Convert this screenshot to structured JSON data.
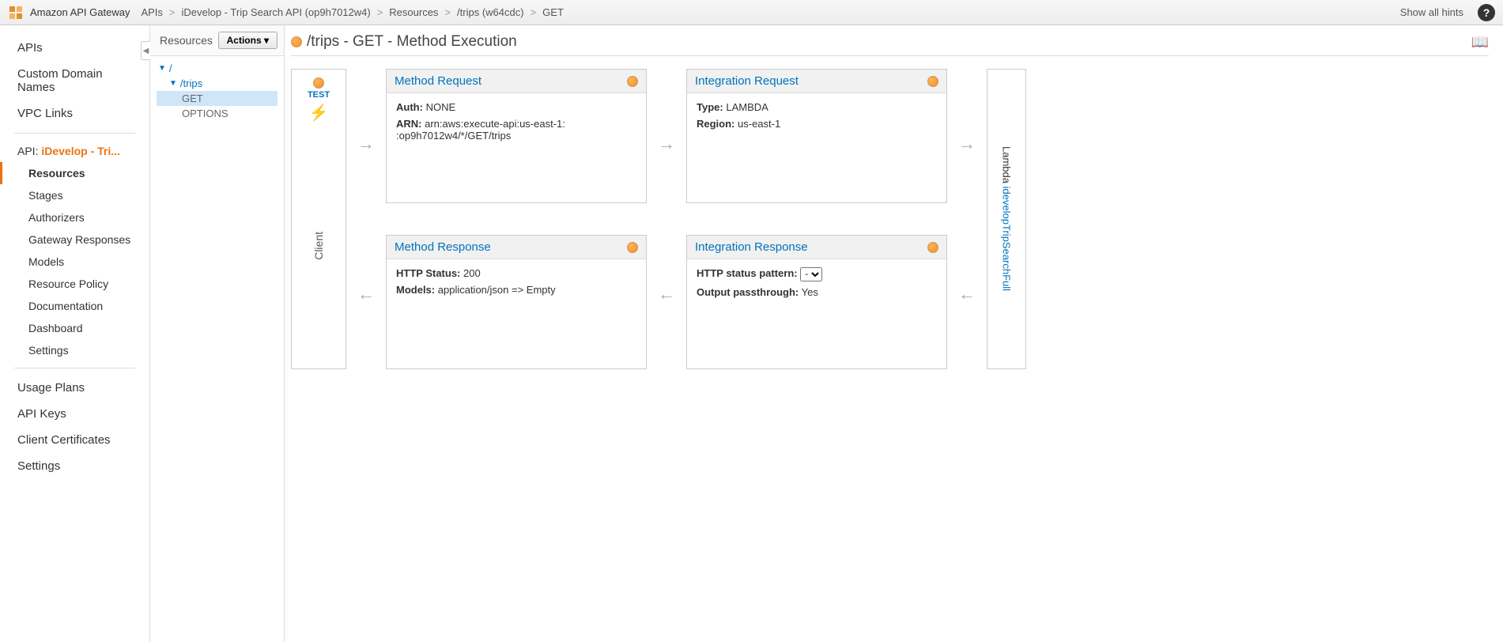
{
  "topbar": {
    "service": "Amazon API Gateway",
    "crumbs": [
      "APIs",
      "iDevelop - Trip Search API (op9h7012w4)",
      "Resources",
      "/trips (w64cdc)",
      "GET"
    ],
    "show_hints": "Show all hints"
  },
  "sidebar": {
    "items_top": [
      "APIs",
      "Custom Domain Names",
      "VPC Links"
    ],
    "api_label_prefix": "API: ",
    "api_name": "iDevelop - Tri...",
    "sub_items": [
      "Resources",
      "Stages",
      "Authorizers",
      "Gateway Responses",
      "Models",
      "Resource Policy",
      "Documentation",
      "Dashboard",
      "Settings"
    ],
    "items_bottom": [
      "Usage Plans",
      "API Keys",
      "Client Certificates",
      "Settings"
    ]
  },
  "resources": {
    "title": "Resources",
    "actions": "Actions",
    "root": "/",
    "trips": "/trips",
    "get": "GET",
    "options": "OPTIONS"
  },
  "main": {
    "title": "/trips - GET - Method Execution",
    "client": {
      "test": "TEST",
      "label": "Client"
    },
    "method_request": {
      "title": "Method Request",
      "auth_label": "Auth:",
      "auth_value": "NONE",
      "arn_label": "ARN:",
      "arn_value": "arn:aws:execute-api:us-east-1:                         :op9h7012w4/*/GET/trips"
    },
    "integration_request": {
      "title": "Integration Request",
      "type_label": "Type:",
      "type_value": "LAMBDA",
      "region_label": "Region:",
      "region_value": "us-east-1"
    },
    "method_response": {
      "title": "Method Response",
      "status_label": "HTTP Status:",
      "status_value": "200",
      "models_label": "Models:",
      "models_value": "application/json => Empty"
    },
    "integration_response": {
      "title": "Integration Response",
      "pattern_label": "HTTP status pattern:",
      "pattern_value": "-",
      "passthrough_label": "Output passthrough:",
      "passthrough_value": "Yes"
    },
    "lambda": {
      "prefix": "Lambda ",
      "name": "idevelopTripSearchFull"
    }
  }
}
